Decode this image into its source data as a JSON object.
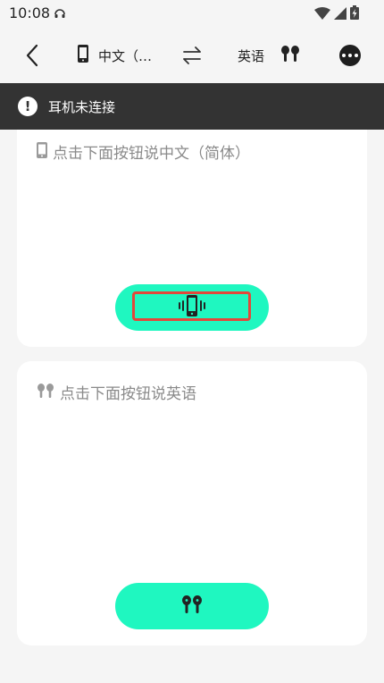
{
  "status_bar": {
    "time": "10:08"
  },
  "app_bar": {
    "source_language": "中文（…",
    "target_language": "英语"
  },
  "banner": {
    "icon_glyph": "!",
    "message": "耳机未连接"
  },
  "phone_card": {
    "prompt": "点击下面按钮说中文（简体）"
  },
  "earbuds_card": {
    "prompt": "点击下面按钮说英语"
  },
  "colors": {
    "accent": "#1ff7c0",
    "banner_bg": "#333333",
    "highlight": "#e3473a"
  }
}
